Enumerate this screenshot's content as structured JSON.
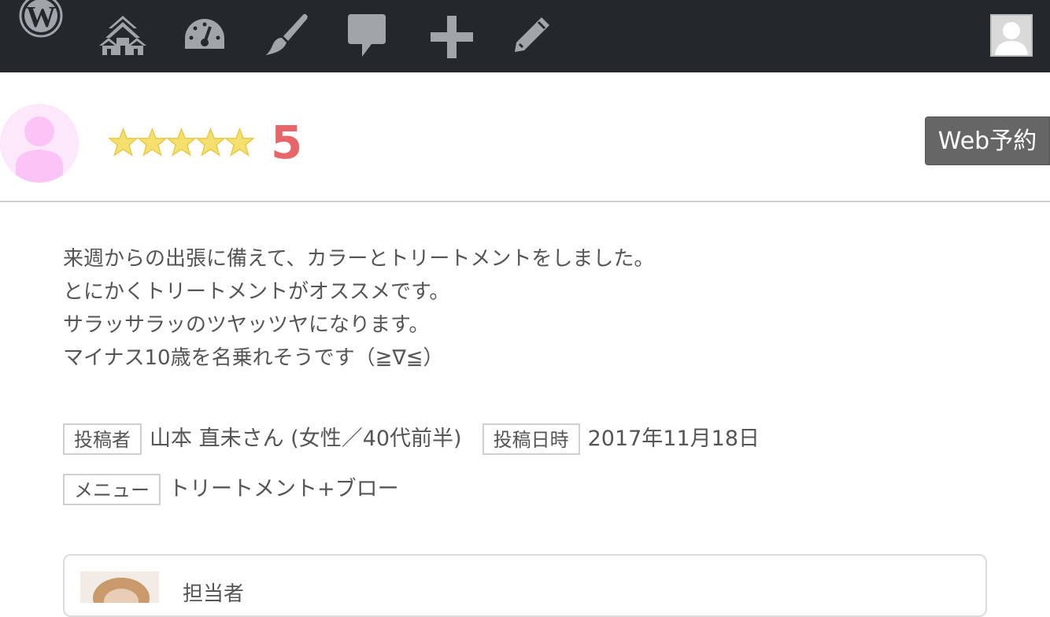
{
  "admin_bar": {
    "icons": [
      "wordpress-icon",
      "sites-icon",
      "dashboard-icon",
      "customize-icon",
      "comments-icon",
      "new-icon",
      "edit-icon"
    ],
    "colors": {
      "background": "#23282d",
      "icon": "#a0a5aa"
    }
  },
  "review": {
    "rating_stars": 5,
    "rating_number": "5",
    "web_reserve_label": "Web予約",
    "body_lines": [
      "来週からの出張に備えて、カラーとトリートメントをしました。",
      "とにかくトリートメントがオススメです。",
      "サラッサラッのツヤッツヤになります。",
      "マイナス10歳を名乗れそうです（≧∇≦）"
    ],
    "poster_label": "投稿者",
    "poster_value": "山本 直未さん (女性／40代前半)",
    "date_label": "投稿日時",
    "date_value": "2017年11月18日",
    "menu_label": "メニュー",
    "menu_value": "トリートメント+ブロー",
    "staff_label": "担当者"
  },
  "colors": {
    "rating": "#e8666a",
    "star": "#f5e06e",
    "button_bg": "#666666",
    "avatar_bg": "#fde8fb"
  }
}
